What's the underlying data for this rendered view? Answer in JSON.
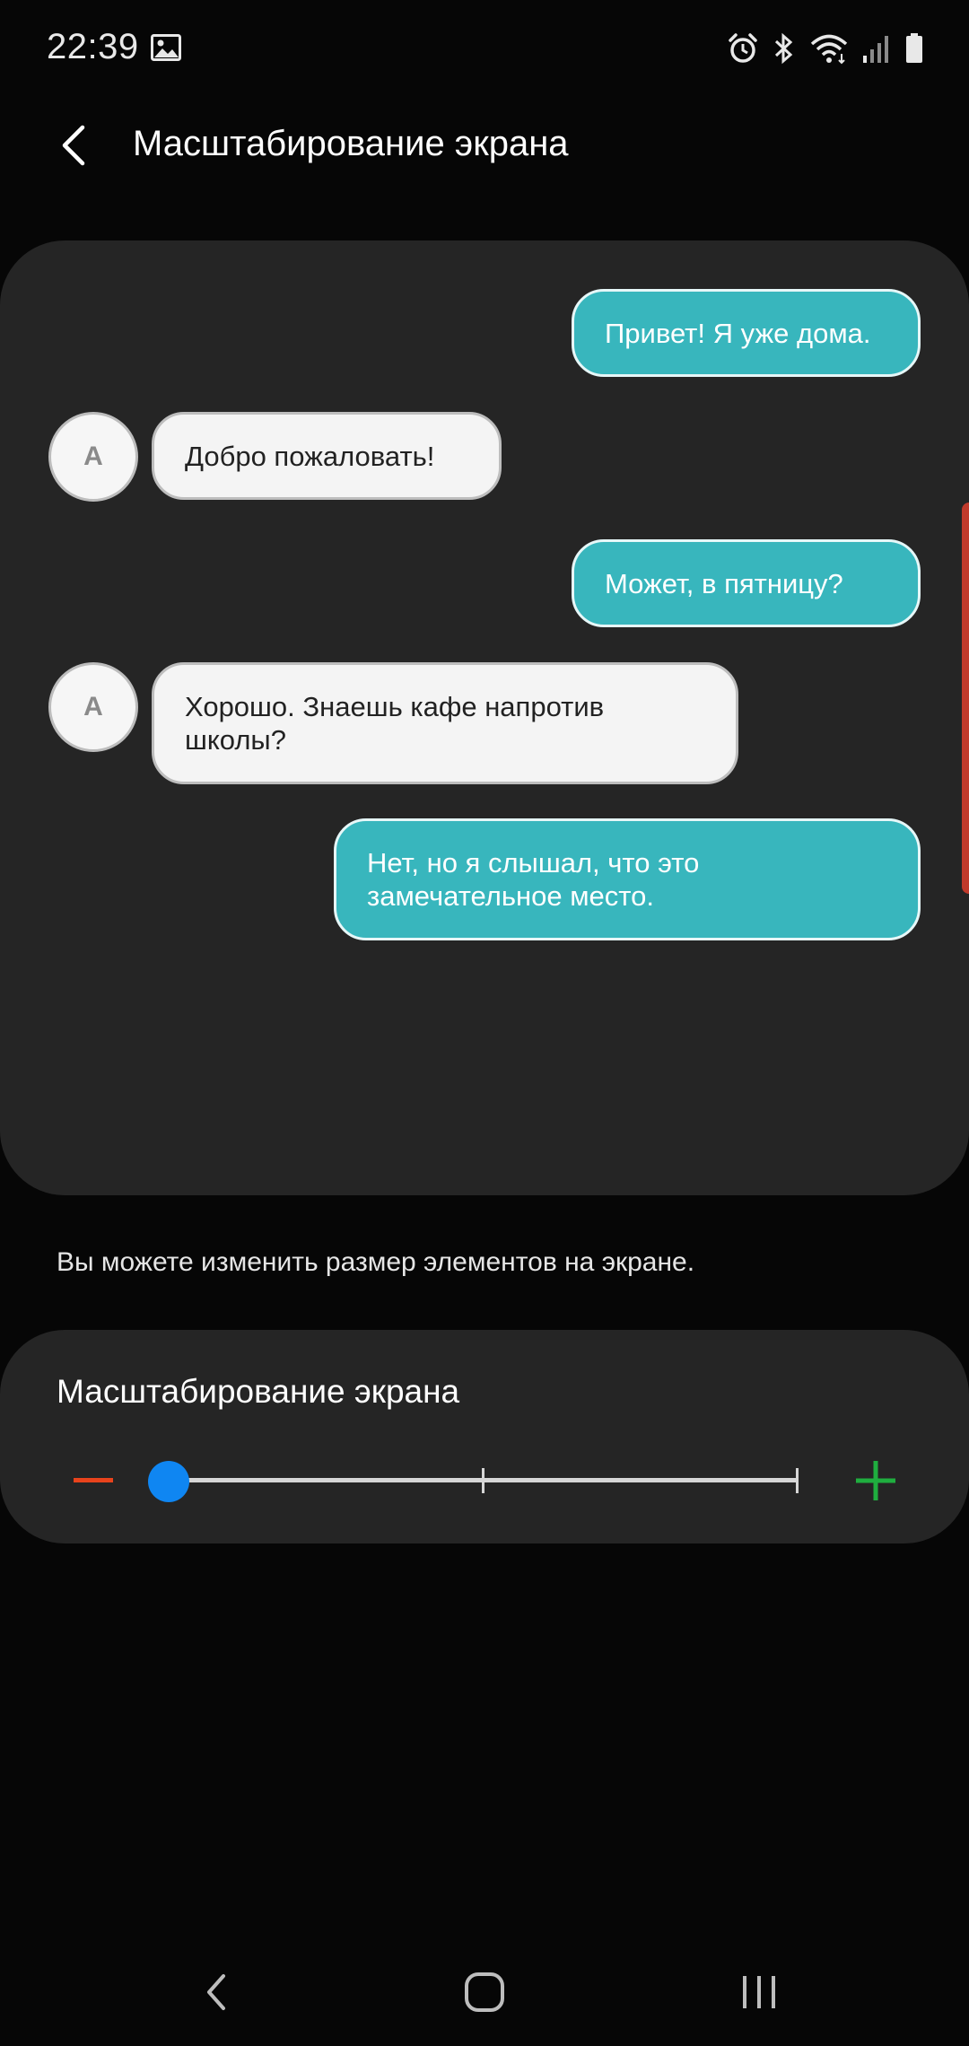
{
  "status_bar": {
    "time": "22:39",
    "left_icons": [
      "gallery-icon"
    ],
    "right_icons": [
      "alarm-icon",
      "bluetooth-icon",
      "wifi-icon",
      "signal-icon",
      "battery-icon"
    ]
  },
  "app_bar": {
    "title": "Масштабирование экрана",
    "back_icon": "chevron-left-icon"
  },
  "preview": {
    "messages": [
      {
        "side": "sent",
        "text": "Привет! Я уже дома."
      },
      {
        "side": "received",
        "avatar": "A",
        "text": "Добро пожаловать!"
      },
      {
        "side": "sent",
        "text": "Может, в пятницу?"
      },
      {
        "side": "received",
        "avatar": "A",
        "text": "Хорошо. Знаешь кафе напротив школы?"
      },
      {
        "side": "sent",
        "text": "Нет, но я слышал, что это замечательное место."
      }
    ]
  },
  "description": "Вы можете изменить размер элементов на экране.",
  "zoom": {
    "title": "Масштабирование экрана",
    "minus_icon": "minus-icon",
    "plus_icon": "plus-icon",
    "level": 0,
    "levels": 3,
    "colors": {
      "minus": "#e8431c",
      "plus": "#1fae3f",
      "thumb": "#0f86f2"
    }
  },
  "nav_bar": {
    "buttons": [
      "back-nav-icon",
      "home-nav-icon",
      "recent-apps-icon"
    ]
  },
  "colors": {
    "background": "#060606",
    "card": "#252525",
    "sent_bubble": "#38b6bd",
    "received_bubble": "#f4f4f4"
  }
}
